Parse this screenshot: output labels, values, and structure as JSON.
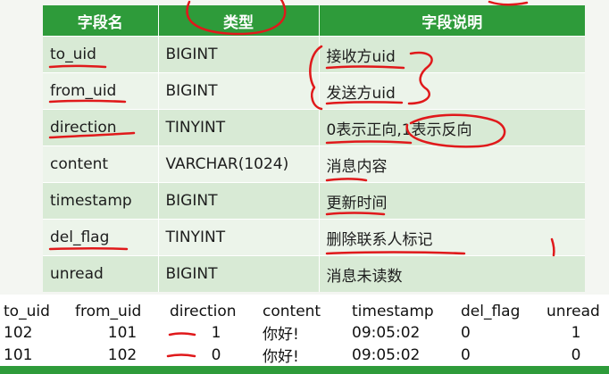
{
  "schema_table": {
    "headers": [
      "字段名",
      "类型",
      "字段说明"
    ],
    "rows": [
      {
        "name": "to_uid",
        "type": "BIGINT",
        "desc": "接收方uid"
      },
      {
        "name": "from_uid",
        "type": "BIGINT",
        "desc": "发送方uid"
      },
      {
        "name": "direction",
        "type": "TINYINT",
        "desc": "0表示正向,1表示反向"
      },
      {
        "name": "content",
        "type": "VARCHAR(1024)",
        "desc": "消息内容"
      },
      {
        "name": "timestamp",
        "type": "BIGINT",
        "desc": "更新时间"
      },
      {
        "name": "del_flag",
        "type": "TINYINT",
        "desc": "删除联系人标记"
      },
      {
        "name": "unread",
        "type": "BIGINT",
        "desc": "消息未读数"
      }
    ]
  },
  "result_table": {
    "headers": [
      "to_uid",
      "from_uid",
      "direction",
      "content",
      "timestamp",
      "del_flag",
      "unread"
    ],
    "rows": [
      [
        "102",
        "101",
        "1",
        "你好!",
        "09:05:02",
        "0",
        "1"
      ],
      [
        "101",
        "102",
        "0",
        "你好!",
        "09:05:02",
        "0",
        "0"
      ]
    ]
  },
  "colors": {
    "header_green": "#2e9b3a",
    "row_odd": "#d8ead5",
    "row_even": "#ecf4ea",
    "annotation_red": "#e0191b"
  }
}
